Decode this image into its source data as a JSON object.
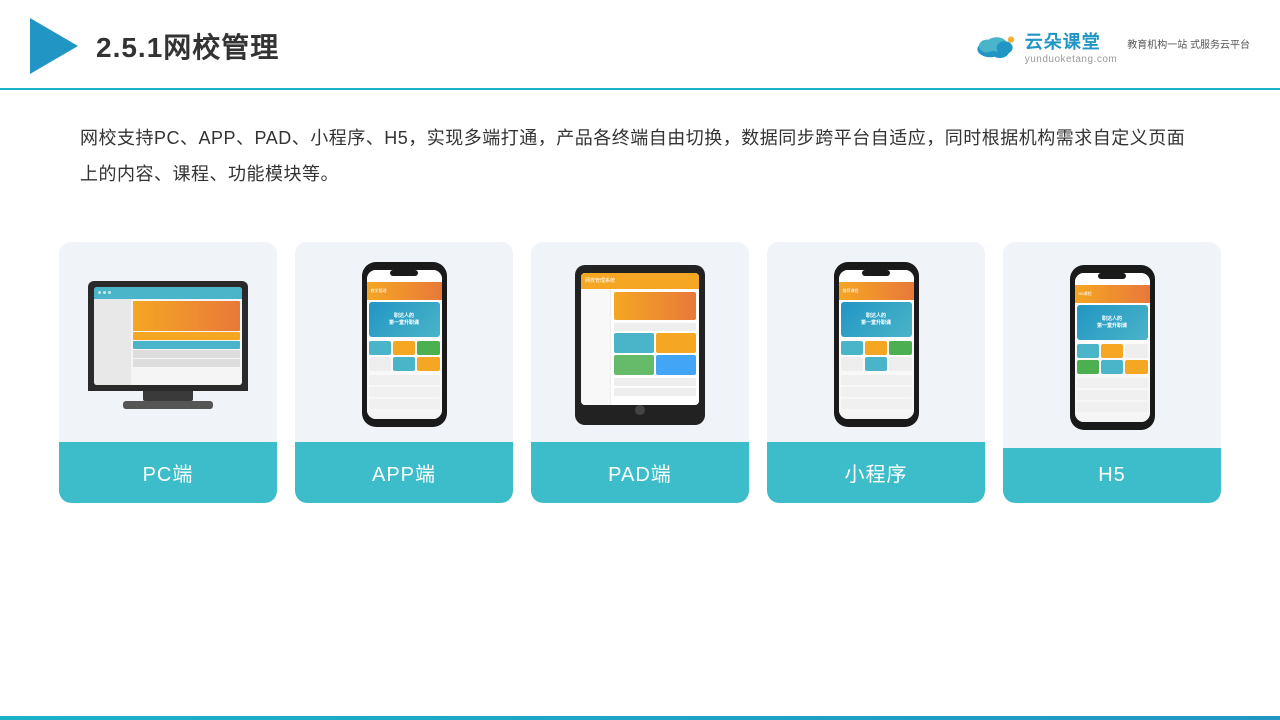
{
  "header": {
    "title": "2.5.1网校管理",
    "brand": {
      "name": "云朵课堂",
      "url": "yunduoketang.com",
      "tagline": "教育机构一站\n式服务云平台"
    }
  },
  "description": {
    "text": "网校支持PC、APP、PAD、小程序、H5，实现多端打通，产品各终端自由切换，数据同步跨平台自适应，同时根据机构需求自定义页面上的内容、课程、功能模块等。"
  },
  "cards": [
    {
      "label": "PC端"
    },
    {
      "label": "APP端"
    },
    {
      "label": "PAD端"
    },
    {
      "label": "小程序"
    },
    {
      "label": "H5"
    }
  ],
  "colors": {
    "teal": "#3dbdca",
    "blue": "#2196c4",
    "accent_line": "#1ab3c8"
  }
}
